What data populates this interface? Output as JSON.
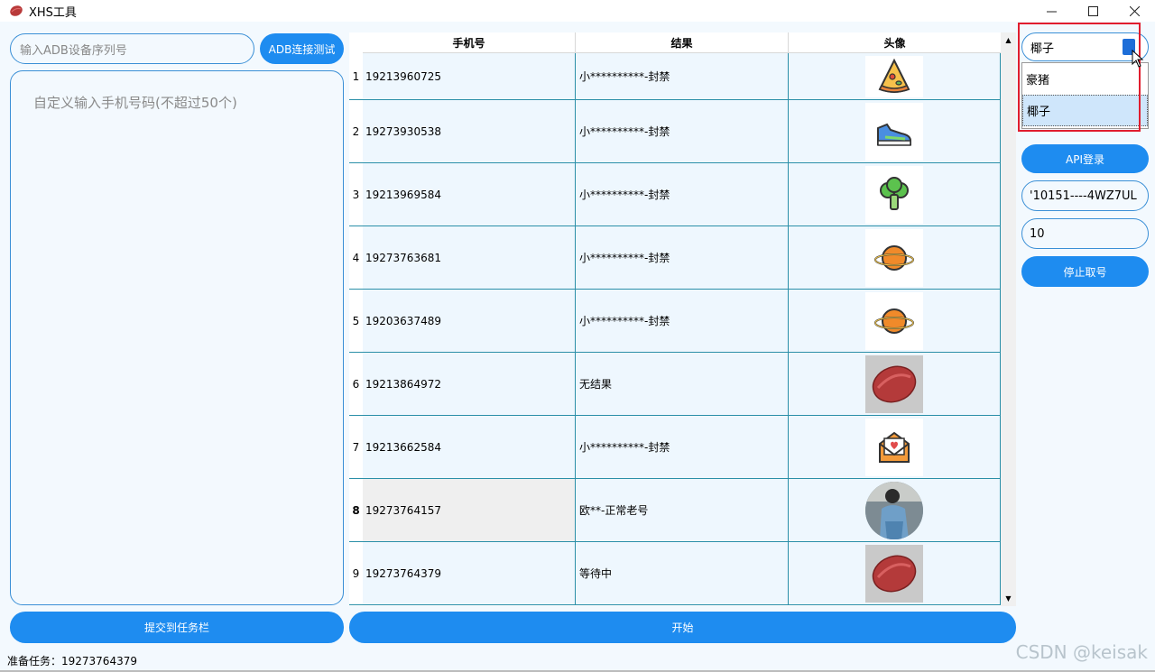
{
  "window": {
    "title": "XHS工具"
  },
  "left": {
    "adb_placeholder": "输入ADB设备序列号",
    "adb_button": "ADB连接测试",
    "phone_area_placeholder": "自定义输入手机号码(不超过50个)",
    "submit_button": "提交到任务栏"
  },
  "table": {
    "headers": [
      "手机号",
      "结果",
      "头像"
    ],
    "rows": [
      {
        "num": "1",
        "phone": "19213960725",
        "result": "小**********-封禁",
        "avatar": "pizza-icon"
      },
      {
        "num": "2",
        "phone": "19273930538",
        "result": "小**********-封禁",
        "avatar": "sneaker-icon"
      },
      {
        "num": "3",
        "phone": "19213969584",
        "result": "小**********-封禁",
        "avatar": "broccoli-icon"
      },
      {
        "num": "4",
        "phone": "19273763681",
        "result": "小**********-封禁",
        "avatar": "planet-icon"
      },
      {
        "num": "5",
        "phone": "19203637489",
        "result": "小**********-封禁",
        "avatar": "planet-icon"
      },
      {
        "num": "6",
        "phone": "19213864972",
        "result": "无结果",
        "avatar": "red-bean-logo"
      },
      {
        "num": "7",
        "phone": "19213662584",
        "result": "小**********-封禁",
        "avatar": "love-letter-icon"
      },
      {
        "num": "8",
        "phone": "19273764157",
        "result": "欧**-正常老号",
        "avatar": "user-photo"
      },
      {
        "num": "9",
        "phone": "19273764379",
        "result": "等待中",
        "avatar": "red-bean-logo"
      }
    ]
  },
  "start_button": "开始",
  "status": "准备任务：19273764379",
  "right": {
    "combo_value": "椰子",
    "dropdown_options": [
      "豪猪",
      "椰子"
    ],
    "dropdown_selected": "椰子",
    "api_button": "API登录",
    "token_value": "'10151----4WZ7UL",
    "count_value": "10",
    "stop_button": "停止取号"
  },
  "watermark": "CSDN @keisak",
  "colors": {
    "accent": "#1e8cf0",
    "grid": "#2a8fa8",
    "highlight": "#e11d2e"
  }
}
